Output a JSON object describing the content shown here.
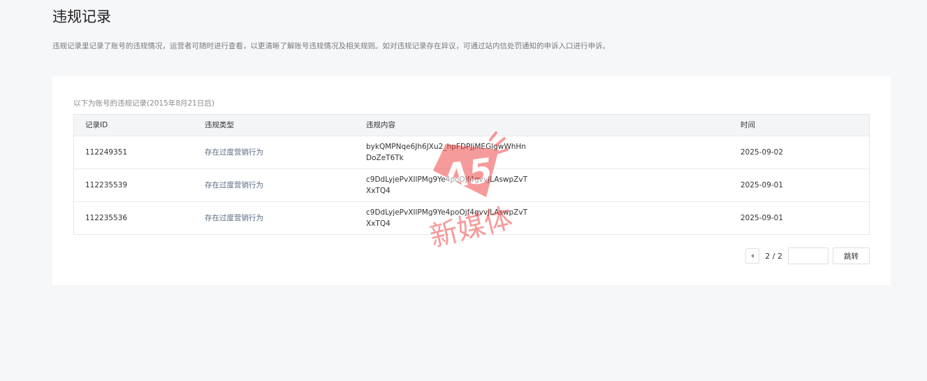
{
  "page": {
    "title": "违规记录",
    "description": "违规记录里记录了账号的违规情况，运营者可随时进行查看，以更清晰了解账号违规情况及相关规则。如对违规记录存在异议，可通过站内信处罚通知的申诉入口进行申诉。"
  },
  "table": {
    "caption": "以下为账号的违规记录(2015年8月21日后)",
    "columns": [
      "记录ID",
      "违规类型",
      "违规内容",
      "时间"
    ],
    "rows": [
      {
        "id": "112249351",
        "type": "存在过度营销行为",
        "content": "bykQMPNqe6Jh6JXu2_hpFDPJjMEGlgwWhHnDoZeT6Tk",
        "time": "2025-09-02"
      },
      {
        "id": "112235539",
        "type": "存在过度营销行为",
        "content": "c9DdLyjePvXIlPMg9Ye4poOjf4gvvJLAswpZvTXxTQ4",
        "time": "2025-09-01"
      },
      {
        "id": "112235536",
        "type": "存在过度营销行为",
        "content": "c9DdLyjePvXIlPMg9Ye4poOjf4gvvJLAswpZvTXxTQ4",
        "time": "2025-09-01"
      }
    ]
  },
  "pagination": {
    "page_info": "2 / 2",
    "jump_label": "跳转",
    "input_value": ""
  },
  "watermark": {
    "logo_text": "A5",
    "label": "新媒体",
    "color": "#f04a4a"
  },
  "icons": {
    "prev": "chevron-left-icon"
  }
}
